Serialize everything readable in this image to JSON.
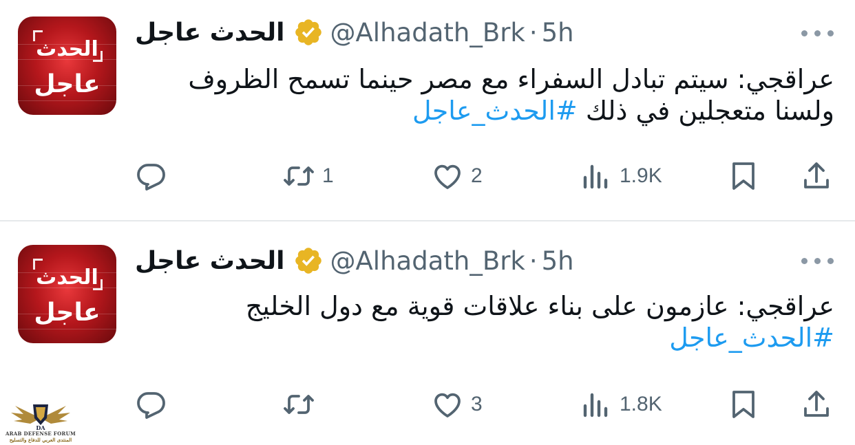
{
  "tweets": [
    {
      "avatar": {
        "line1": "الحدث",
        "line2": "عاجل"
      },
      "name": "الحدث عاجل",
      "handle": "@Alhadath_Brk",
      "separator": "·",
      "time": "5h",
      "text": "عراقجي: سيتم تبادل السفراء مع مصر حينما تسمح الظروف ولسنا متعجلين في ذلك",
      "hashtag": "#الحدث_عاجل",
      "stats": {
        "replies": "",
        "retweets": "1",
        "likes": "2",
        "views": "1.9K"
      }
    },
    {
      "avatar": {
        "line1": "الحدث",
        "line2": "عاجل"
      },
      "name": "الحدث عاجل",
      "handle": "@Alhadath_Brk",
      "separator": "·",
      "time": "5h",
      "text": "عراقجي: عازمون على بناء علاقات قوية مع دول الخليج",
      "hashtag": "#الحدث_عاجل",
      "stats": {
        "replies": "",
        "retweets": "",
        "likes": "3",
        "views": "1.8K"
      }
    }
  ],
  "watermark": {
    "line1": "ARAB DEFENSE FORUM",
    "line2": "المنتدى العربي للدفاع والتسليح"
  },
  "colors": {
    "text": "#0f1419",
    "secondary": "#536471",
    "link": "#1d9bf0",
    "verified": "#e8b524",
    "divider": "#e6e9eb"
  },
  "icons": [
    "reply-icon",
    "retweet-icon",
    "like-icon",
    "views-icon",
    "bookmark-icon",
    "share-icon",
    "more-icon",
    "verified-badge-icon"
  ]
}
